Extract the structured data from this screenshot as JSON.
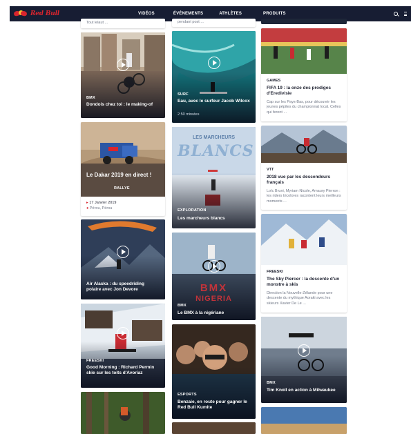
{
  "header": {
    "brand": "Red Bull",
    "nav": [
      {
        "label": "VIDÉOS"
      },
      {
        "label": "ÉVÉNEMENTS"
      },
      {
        "label": "ATHLÈTES"
      },
      {
        "label": "PRODUITS"
      }
    ],
    "icons": [
      "search-icon",
      "menu-icon"
    ]
  },
  "column1": {
    "stub_text": "Tout lelaut ...",
    "cards": [
      {
        "tag": "BMX",
        "title": "Dondois chez toi : le making-of",
        "video": true
      },
      {
        "title": "Le Dakar 2019 en direct !",
        "badge": "RALLYE",
        "date": "17 Janvier 2019",
        "location": "Pérou, Pérou",
        "video": false
      },
      {
        "title": "Air Alaska : du speedriding polaire avec Jon Devore",
        "video": true
      },
      {
        "tag": "FREESKI",
        "title": "Good Morning : Richard Permin skie sur les toits d'Avoriaz",
        "video": true
      }
    ]
  },
  "column2": {
    "stub_text": "pendant post ...",
    "cards": [
      {
        "tag": "SURF",
        "title": "Eau, avec le surfeur Jacob Wilcox",
        "duration": "2:50 minutes",
        "video": true
      },
      {
        "overlay": "LES MARCHEURS BLANCS",
        "overlay_top": "LES MARCHEURS",
        "overlay_big": "BLANCS",
        "tag": "EXPLORATION",
        "title": "Les marcheurs blancs",
        "video": false
      },
      {
        "overlay": "BMX NIGERIA",
        "overlay_top": "BMX",
        "overlay_big": "NIGERIA",
        "tag": "BMX",
        "title": "Le BMX à la nigériane",
        "video": true
      },
      {
        "tag": "ESPORTS",
        "title": "Benzaie, en route pour gagner le Red Bull Kumite",
        "video": false
      }
    ]
  },
  "column3": {
    "cards": [
      {
        "tag": "GAMES",
        "title": "FIFA 19 : la onze des prodiges d'Eredivisie",
        "desc": "Cap sur les Pays-Bas, pour découvrir les jeunes pépites du championnat local. Celles qui feront ..."
      },
      {
        "tag": "VTT",
        "title": "2018 vue par les descendeurs français",
        "desc": "Loïc Bruni, Myriam Nicole, Amaury Pierron : les riders tricolores racontent leurs meilleurs moments ..."
      },
      {
        "tag": "FREESKI",
        "title": "The Sky Piercer : la descente d'un monstre à skis",
        "desc": "Direction la Nouvelle-Zélande pour une descente du mythique Aoraki avec les skieurs Xavier De Le ..."
      },
      {
        "tag": "BMX",
        "title": "Tim Knoll en action à Milwaukee",
        "video": true
      }
    ]
  },
  "colors": {
    "nav_bg": "#171d33",
    "brand_red": "#d8252e",
    "brand_yellow": "#f3c431",
    "text_dark": "#1e2130",
    "text_muted": "#707786",
    "location_red": "#d8252e"
  }
}
